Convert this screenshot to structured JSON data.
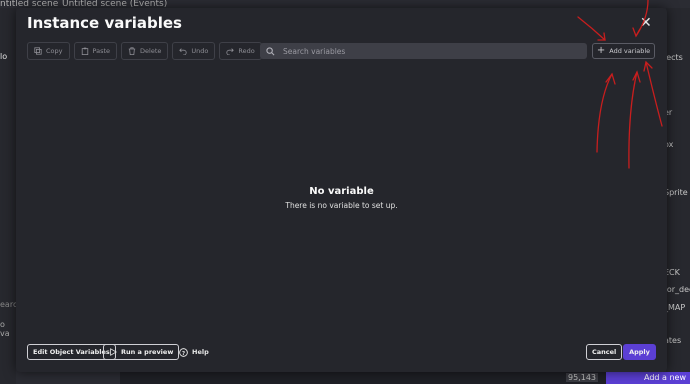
{
  "background": {
    "tabs": [
      "ntitled scene",
      "Untitled scene (Events)"
    ],
    "right_panel": [
      "jects",
      "er",
      "ox",
      "Sprite",
      "ECK",
      "for_dec",
      "_MAP",
      "ates"
    ],
    "left_panel": [
      "lo",
      "earc",
      "o va"
    ],
    "coords": "95,143",
    "add_new_label": "Add a new"
  },
  "dialog": {
    "title": "Instance variables",
    "toolbar": {
      "copy": "Copy",
      "paste": "Paste",
      "delete": "Delete",
      "undo": "Undo",
      "redo": "Redo"
    },
    "search": {
      "placeholder": "Search variables",
      "value": ""
    },
    "add_variable": "Add variable",
    "empty": {
      "title": "No variable",
      "subtitle": "There is no variable to set up."
    },
    "footer": {
      "edit_object_variables": "Edit Object Variables",
      "run_preview": "Run a preview",
      "help": "Help",
      "cancel": "Cancel",
      "apply": "Apply"
    }
  },
  "colors": {
    "accent": "#5b3fd4",
    "dialog_bg": "#25262c",
    "annotation": "#c81e1e"
  }
}
